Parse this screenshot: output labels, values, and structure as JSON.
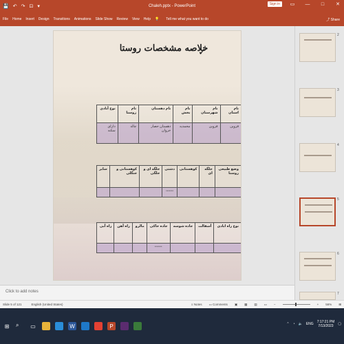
{
  "titlebar": {
    "doc_title": "Chaleh.pptx - PowerPoint",
    "sign_in": "Sign in"
  },
  "ribbon": {
    "tabs": [
      "File",
      "Home",
      "Insert",
      "Design",
      "Transitions",
      "Animations",
      "Slide Show",
      "Review",
      "View",
      "Help"
    ],
    "tell_me": "Tell me what you want to do",
    "share": "Share"
  },
  "slide": {
    "title": "خلاصه مشخصات روستا",
    "check": "✓",
    "table1": {
      "headers": [
        "نام استان",
        "نام شهرستان",
        "نام بخش",
        "نام دهستان",
        "نام روستا",
        "نوع آبادی"
      ],
      "row": [
        "قزوین",
        "قزوین",
        "محمدیه",
        "دهستان حصار خروان",
        "چاله",
        "دارای سکنه"
      ]
    },
    "table2": {
      "headers": [
        "وضع طبیعی روستا",
        "جلگه ای",
        "کوهستانی",
        "دشتی",
        "جلگه ای و جلگی",
        "کوهستانی و جنگلی",
        "سایر"
      ],
      "row": [
        "",
        "",
        "",
        "*******",
        "",
        "",
        ""
      ]
    },
    "table3": {
      "headers": [
        "نوع راه ابادی",
        "آسفالت",
        "جاده شوسه",
        "جاده خاکی",
        "مالرو",
        "راه آهن",
        "راه آبی"
      ],
      "row": [
        "",
        "",
        "",
        "*******",
        "",
        "",
        ""
      ]
    }
  },
  "notes": {
    "placeholder": "Click to add notes"
  },
  "thumbnails": [
    {
      "num": "2"
    },
    {
      "num": "3"
    },
    {
      "num": "4"
    },
    {
      "num": "5"
    },
    {
      "num": "6"
    },
    {
      "num": "7"
    }
  ],
  "status": {
    "slide_count": "Slide 5 of 121",
    "language": "English (United States)",
    "notes": "Notes",
    "comments": "Comments",
    "zoom": "56%"
  },
  "taskbar": {
    "lang": "ENG",
    "time": "7:17:21 PM",
    "date": "7/13/2023"
  },
  "colors": {
    "accent": "#b7472a",
    "taskbar": "#1f2a3c"
  }
}
